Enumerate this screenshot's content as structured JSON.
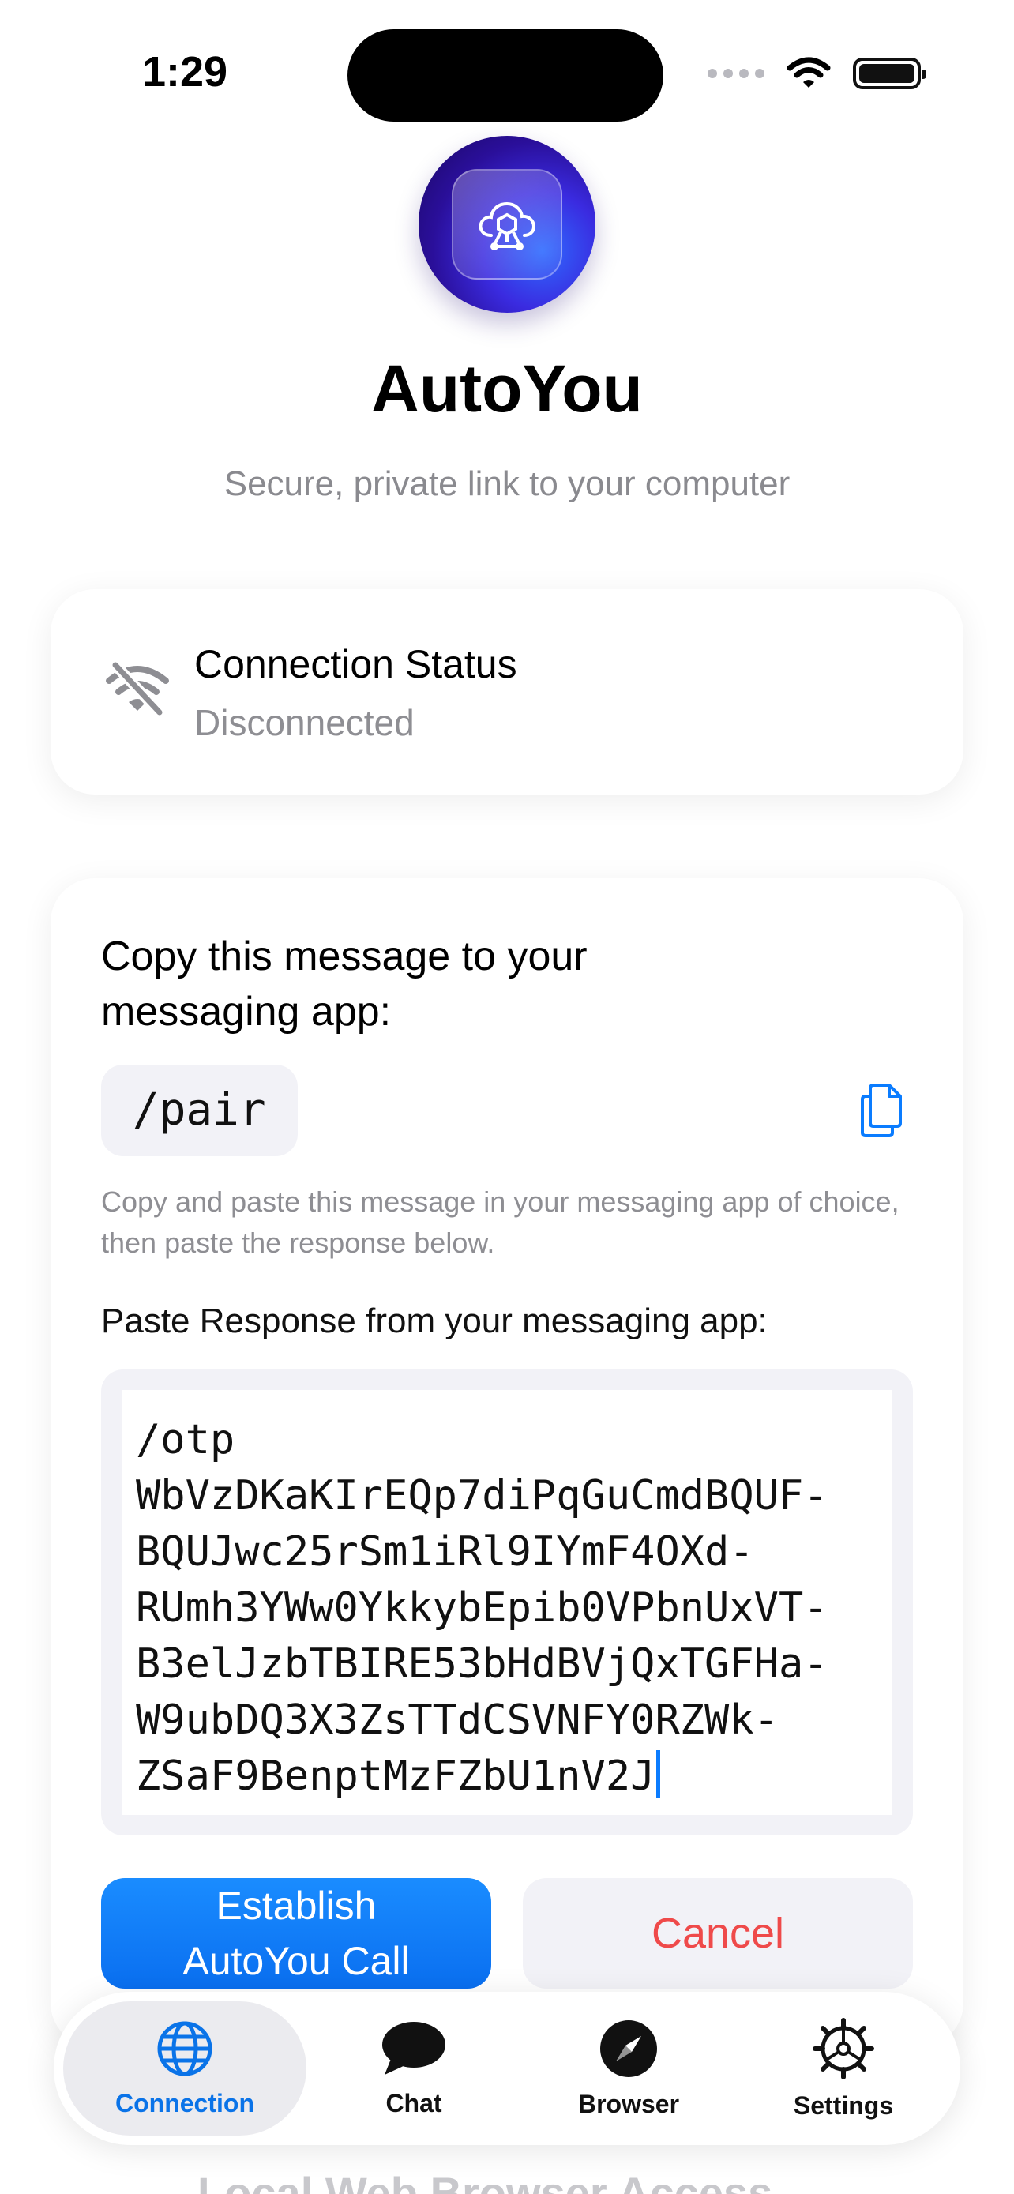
{
  "status_bar": {
    "time": "1:29"
  },
  "app": {
    "title": "AutoYou",
    "subtitle": "Secure, private link to your computer",
    "logo_icon": "cloud-network-icon"
  },
  "connection_card": {
    "title": "Connection Status",
    "status": "Disconnected",
    "icon": "wifi-off-icon"
  },
  "pairing": {
    "heading": "Copy this message to your messaging app:",
    "command": "/pair",
    "copy_icon": "copy-icon",
    "hint": "Copy and paste this message in your messaging app of choice, then paste the response below.",
    "paste_label": "Paste Response from your messaging app:",
    "response": "/otp\nWbVzDKaKIrEQp7diPqGuCmdBQUF-\nBQUJwc25rSm1iRl9IYmF4OXd-\nRUmh3YWw0YkkybEpib0VPbnUxVT-\nB3elJzbTBIRE53bHdBVjQxTGFHa-\nW9ubDQ3X3ZsTTdCSVNFY0RZWk-\nZSaF9BenptMzFZbU1nV2J",
    "primary_button": "Establish\nAutoYou Call",
    "cancel_button": "Cancel"
  },
  "peek_section": "Local Web Browser Access",
  "tabs": [
    {
      "label": "Connection",
      "icon": "globe-icon",
      "active": true
    },
    {
      "label": "Chat",
      "icon": "chat-bubble-icon",
      "active": false
    },
    {
      "label": "Browser",
      "icon": "compass-icon",
      "active": false
    },
    {
      "label": "Settings",
      "icon": "gear-icon",
      "active": false
    }
  ],
  "colors": {
    "accent": "#0A7CFF",
    "danger": "#EF4A4A",
    "muted": "#8E8E93",
    "surface": "#F2F2F7"
  }
}
